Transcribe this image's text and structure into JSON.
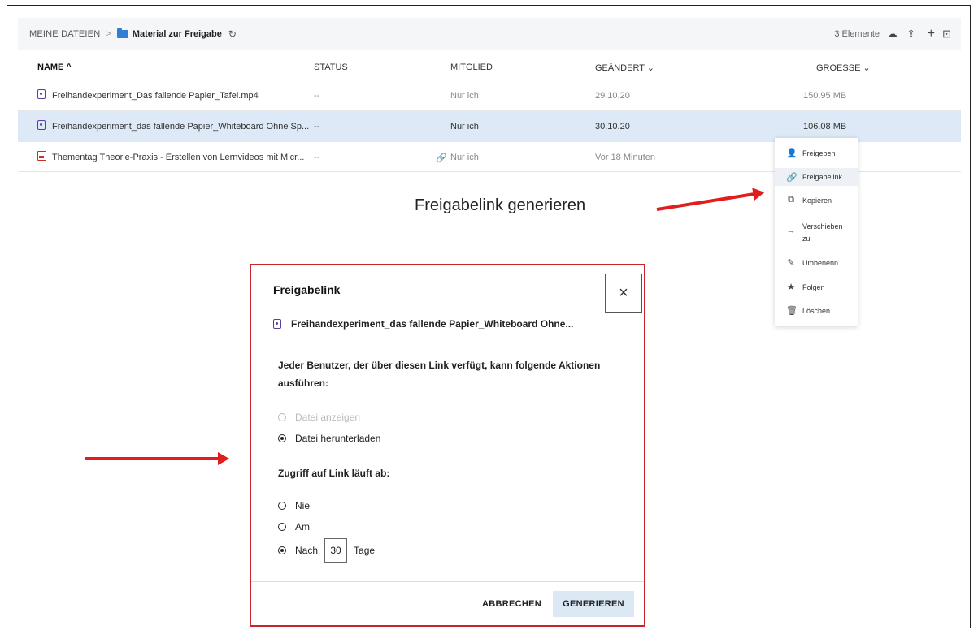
{
  "breadcrumb": {
    "root": "MEINE DATEIEN",
    "separator": ">",
    "current": "Material zur Freigabe"
  },
  "header": {
    "count": "3 Elemente"
  },
  "table": {
    "columns": [
      "NAME ^",
      "STATUS",
      "MITGLIED",
      "GEÄNDERT ⌄",
      "GROESSE ⌄"
    ],
    "rows": [
      {
        "name": "Freihandexperiment_Das fallende Papier_Tafel.mp4",
        "status": "--",
        "member": "Nur ich",
        "changed": "29.10.20",
        "size": "150.95 MB",
        "type": "video",
        "selected": false
      },
      {
        "name": "Freihandexperiment_das fallende Papier_Whiteboard Ohne Sp...",
        "status": "--",
        "member": "Nur ich",
        "changed": "30.10.20",
        "size": "106.08 MB",
        "type": "video",
        "selected": true
      },
      {
        "name": "Thementag Theorie-Praxis - Erstellen von Lernvideos mit Micr...",
        "status": "--",
        "member": "Nur ich",
        "changed": "Vor 18 Minuten",
        "size": "",
        "type": "ppt",
        "selected": false
      }
    ]
  },
  "context_menu": {
    "items": [
      {
        "label": "Freigeben",
        "icon": "share-user-icon"
      },
      {
        "label": "Freigabelink",
        "icon": "link-icon"
      },
      {
        "label": "Kopieren",
        "icon": "copy-icon"
      },
      {
        "label": "Verschieben",
        "label2": "zu",
        "icon": "arrow-right-icon"
      },
      {
        "label": "Umbenenn...",
        "icon": "pencil-icon"
      },
      {
        "label": "Folgen",
        "icon": "star-icon"
      },
      {
        "label": "Löschen",
        "icon": "trash-icon"
      }
    ]
  },
  "annotation": {
    "text": "Freigabelink generieren"
  },
  "dialog": {
    "title": "Freigabelink",
    "close": "×",
    "file": "Freihandexperiment_das fallende Papier_Whiteboard Ohne...",
    "desc": "Jeder Benutzer, der über diesen Link verfügt, kann folgende Aktionen ausführen:",
    "options": [
      {
        "label": "Datei anzeigen",
        "checked": false,
        "disabled": true
      },
      {
        "label": "Datei herunterladen",
        "checked": true,
        "disabled": false
      }
    ],
    "expiry_title": "Zugriff auf Link läuft ab:",
    "expiry": [
      {
        "label": "Nie",
        "checked": false
      },
      {
        "label": "Am",
        "checked": false
      },
      {
        "label": "Nach",
        "checked": true
      }
    ],
    "days_value": "30",
    "days_unit": "Tage",
    "cancel": "ABBRECHEN",
    "generate": "GENERIEREN"
  },
  "colors": {
    "accent_red": "#e11d1d",
    "selection": "#dde9f6",
    "button_bg": "#dce9f5"
  }
}
